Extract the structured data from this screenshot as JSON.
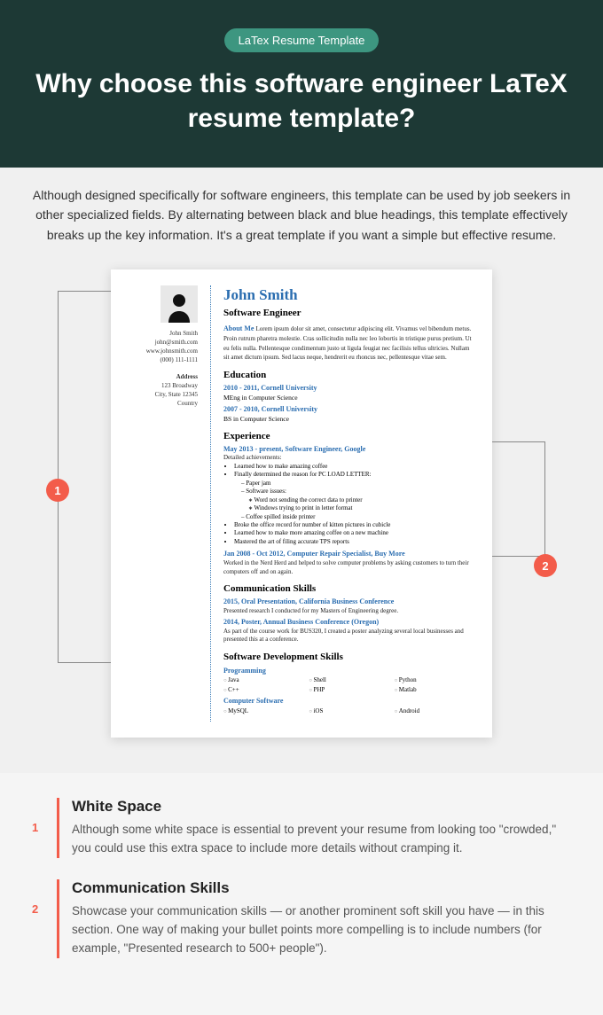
{
  "hero": {
    "badge": "LaTex Resume Template",
    "title": "Why choose this software engineer LaTeX resume template?"
  },
  "intro": "Although designed specifically for software engineers, this template can be used by job seekers in other specialized fields. By alternating between black and blue headings, this template effectively breaks up the key information. It's a great template if you want a simple but effective resume.",
  "callouts": {
    "one": "1",
    "two": "2"
  },
  "resume": {
    "sidebar": {
      "name": "John Smith",
      "email": "john@smith.com",
      "web": "www.johnsmith.com",
      "phone": "(000) 111-1111",
      "addr_h": "Address",
      "addr1": "123 Broadway",
      "addr2": "City, State 12345",
      "addr3": "Country"
    },
    "name": "John Smith",
    "title": "Software Engineer",
    "about_h": "About Me",
    "about": "Lorem ipsum dolor sit amet, consectetur adipiscing elit. Vivamus vel bibendum metus. Proin rutrum pharetra molestie. Cras sollicitudin nulla nec leo lobortis in tristique purus pretium. Ut eu felis nulla. Pellentesque condimentum justo ut ligula feugiat nec facilisis tellus ultricies. Nullam sit amet dictum ipsum. Sed lacus neque, hendrerit eu rhoncus nec, pellentesque vitae sem.",
    "edu_h": "Education",
    "edu": [
      {
        "period": "2010 - 2011, Cornell University",
        "detail": "MEng in Computer Science"
      },
      {
        "period": "2007 - 2010, Cornell University",
        "detail": "BS in Computer Science"
      }
    ],
    "exp_h": "Experience",
    "exp1_head": "May 2013 - present, Software Engineer, Google",
    "exp1_sub": "Detailed achievements:",
    "exp1_b1": "Learned how to make amazing coffee",
    "exp1_b2": "Finally determined the reason for PC LOAD LETTER:",
    "exp1_b2a": "Paper jam",
    "exp1_b2b": "Software issues:",
    "exp1_b2b1": "Word not sending the correct data to printer",
    "exp1_b2b2": "Windows trying to print in letter format",
    "exp1_b2c": "Coffee spilled inside printer",
    "exp1_b3": "Broke the office record for number of kitten pictures in cubicle",
    "exp1_b4": "Learned how to make more amazing coffee on a new machine",
    "exp1_b5": "Mastered the art of filing accurate TPS reports",
    "exp2_head": "Jan 2008 - Oct 2012, Computer Repair Specialist, Buy More",
    "exp2_txt": "Worked in the Nerd Herd and helped to solve computer problems by asking customers to turn their computers off and on again.",
    "comm_h": "Communication Skills",
    "comm1_head": "2015, Oral Presentation, California Business Conference",
    "comm1_txt": "Presented research I conducted for my Masters of Engineering degree.",
    "comm2_head": "2014, Poster, Annual Business Conference (Oregon)",
    "comm2_txt": "As part of the course work for BUS320, I created a poster analyzing several local businesses and presented this at a conference.",
    "dev_h": "Software Development Skills",
    "prog_h": "Programming",
    "prog": [
      "Java",
      "Shell",
      "Python",
      "C++",
      "PHP",
      "Matlab"
    ],
    "soft_h": "Computer Software",
    "soft": [
      "MySQL",
      "iOS",
      "Android"
    ]
  },
  "ann": [
    {
      "num": "1",
      "title": "White Space",
      "body": "Although some white space is essential to prevent your resume from looking too \"crowded,\" you could use this extra space to include more details without cramping it."
    },
    {
      "num": "2",
      "title": "Communication Skills",
      "body": "Showcase your communication skills — or another prominent soft skill you have — in this section. One way of making your bullet points more compelling is to include numbers (for example, \"Presented research to 500+ people\")."
    }
  ]
}
